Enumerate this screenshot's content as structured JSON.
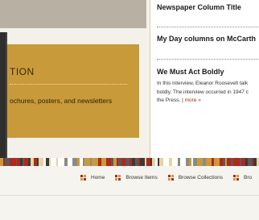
{
  "feature": {
    "title_fragment": "TION",
    "text_fragment": "ochures, posters, and newsletters"
  },
  "columns": {
    "items": [
      {
        "title": "Newspaper Column Title"
      },
      {
        "title": "My Day columns on McCarth"
      },
      {
        "title": "We Must Act Boldly",
        "excerpt_lines": [
          "In this interview, Eleanor Roosevelt talk",
          "boldly. The interview occurred in 1947 c",
          "the Press. |"
        ],
        "more_link": "more »"
      }
    ]
  },
  "nav": {
    "items": [
      {
        "label": "Home"
      },
      {
        "label": "Browse Items"
      },
      {
        "label": "Browse Collections"
      },
      {
        "label": "Bro"
      }
    ]
  },
  "colors": {
    "gold": "#c99a3a",
    "red": "#b0281b",
    "stone": "#b8b1a3",
    "charcoal": "#2f2f2f"
  }
}
